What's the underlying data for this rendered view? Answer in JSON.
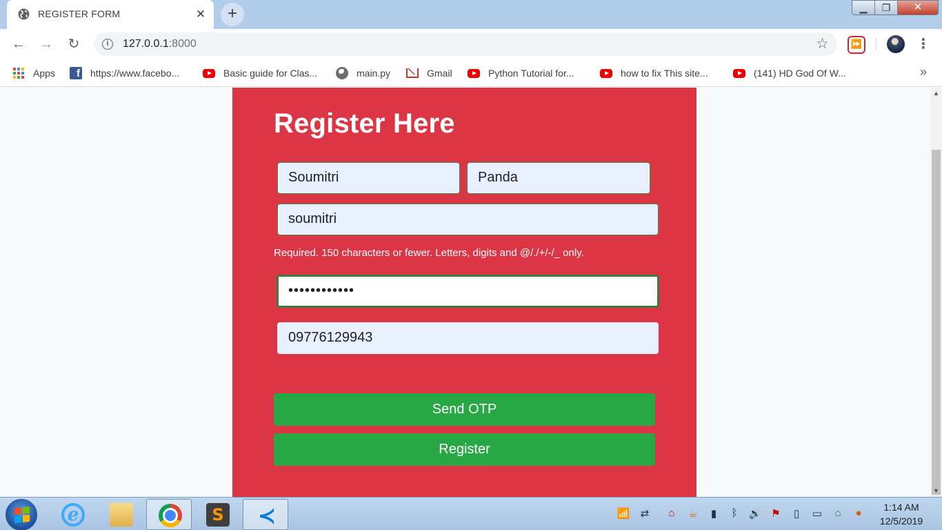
{
  "browser": {
    "tab": {
      "title": "REGISTER FORM",
      "favicon": "globe-icon",
      "close_icon": "close-icon"
    },
    "new_tab_icon": "plus-icon",
    "window_controls": {
      "minimize": "minimize-icon",
      "maximize": "maximize-icon",
      "close": "close-icon"
    },
    "toolbar": {
      "back_icon": "back-arrow-icon",
      "forward_icon": "forward-arrow-icon",
      "reload_icon": "reload-icon",
      "url_host": "127.0.0.1",
      "url_port": ":8000",
      "site_info_icon": "info-icon",
      "bookmark_star_icon": "star-icon"
    },
    "bookmarks": [
      {
        "label": "Apps",
        "icon": "apps-grid-icon"
      },
      {
        "label": "https://www.facebo...",
        "icon": "facebook-icon"
      },
      {
        "label": "Basic guide for Clas...",
        "icon": "youtube-icon"
      },
      {
        "label": "main.py",
        "icon": "globe-icon"
      },
      {
        "label": "Gmail",
        "icon": "gmail-icon"
      },
      {
        "label": "Python Tutorial for...",
        "icon": "youtube-icon"
      },
      {
        "label": "how to fix This site...",
        "icon": "youtube-icon"
      },
      {
        "label": "(141) HD God Of W...",
        "icon": "youtube-icon"
      }
    ],
    "bookmarks_overflow": "»"
  },
  "form": {
    "heading": "Register Here",
    "first_name": "Soumitri",
    "last_name": "Panda",
    "username": "soumitri",
    "username_help": "Required. 150 characters or fewer. Letters, digits and @/./+/-/_ only.",
    "password_mask": "••••••••••••",
    "phone": "09776129943",
    "send_otp_label": "Send OTP",
    "register_label": "Register"
  },
  "colors": {
    "card_bg": "#dc3545",
    "button_bg": "#28a745",
    "input_bg": "#e8f0fe",
    "focus_border": "#3e7a3c"
  },
  "taskbar": {
    "apps": [
      "internet-explorer-icon",
      "file-explorer-icon",
      "chrome-icon",
      "sublime-text-icon",
      "vscode-icon"
    ],
    "clock_time": "1:14 AM",
    "clock_date": "12/5/2019"
  }
}
